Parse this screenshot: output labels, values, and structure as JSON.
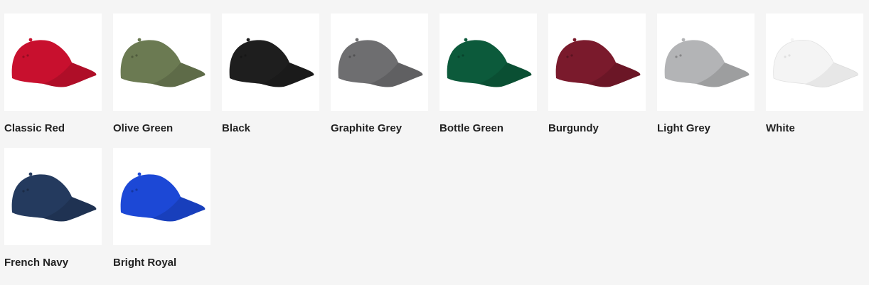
{
  "swatches": [
    {
      "label": "Classic Red",
      "color": "#c8102e"
    },
    {
      "label": "Olive Green",
      "color": "#6b7a52"
    },
    {
      "label": "Black",
      "color": "#1e1e1e"
    },
    {
      "label": "Graphite Grey",
      "color": "#6e6e70"
    },
    {
      "label": "Bottle Green",
      "color": "#0c5a3b"
    },
    {
      "label": "Burgundy",
      "color": "#7a1a2c"
    },
    {
      "label": "Light Grey",
      "color": "#b3b4b6"
    },
    {
      "label": "White",
      "color": "#f4f4f4"
    },
    {
      "label": "French Navy",
      "color": "#243a5e"
    },
    {
      "label": "Bright Royal",
      "color": "#1c48d6"
    }
  ]
}
